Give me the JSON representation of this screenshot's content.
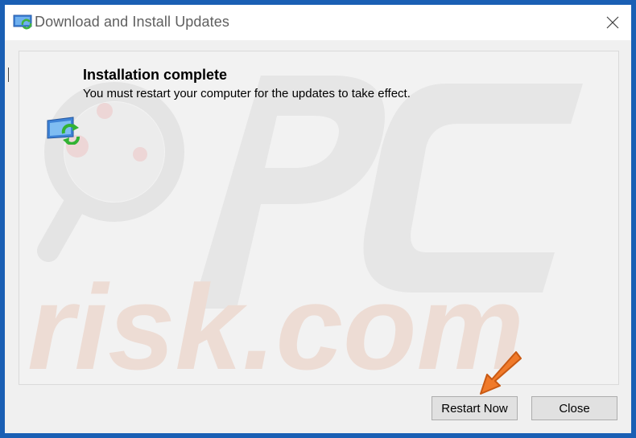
{
  "window": {
    "title": "Download and Install Updates",
    "icon": "windows-update-icon"
  },
  "titlebar": {
    "close_icon": "close-icon"
  },
  "content": {
    "icon": "update-refresh-icon",
    "heading": "Installation complete",
    "message": "You must restart your computer for the updates to take effect."
  },
  "buttons": {
    "restart_label": "Restart Now",
    "close_label": "Close"
  },
  "annotation": {
    "arrow_icon": "orange-arrow-icon",
    "arrow_color": "#f07a2a"
  },
  "watermark": {
    "text": "risk.com",
    "logo": "PC"
  },
  "colors": {
    "frame": "#1a5fb4",
    "titlebar": "#ffffff",
    "body": "#f0f0f0"
  }
}
